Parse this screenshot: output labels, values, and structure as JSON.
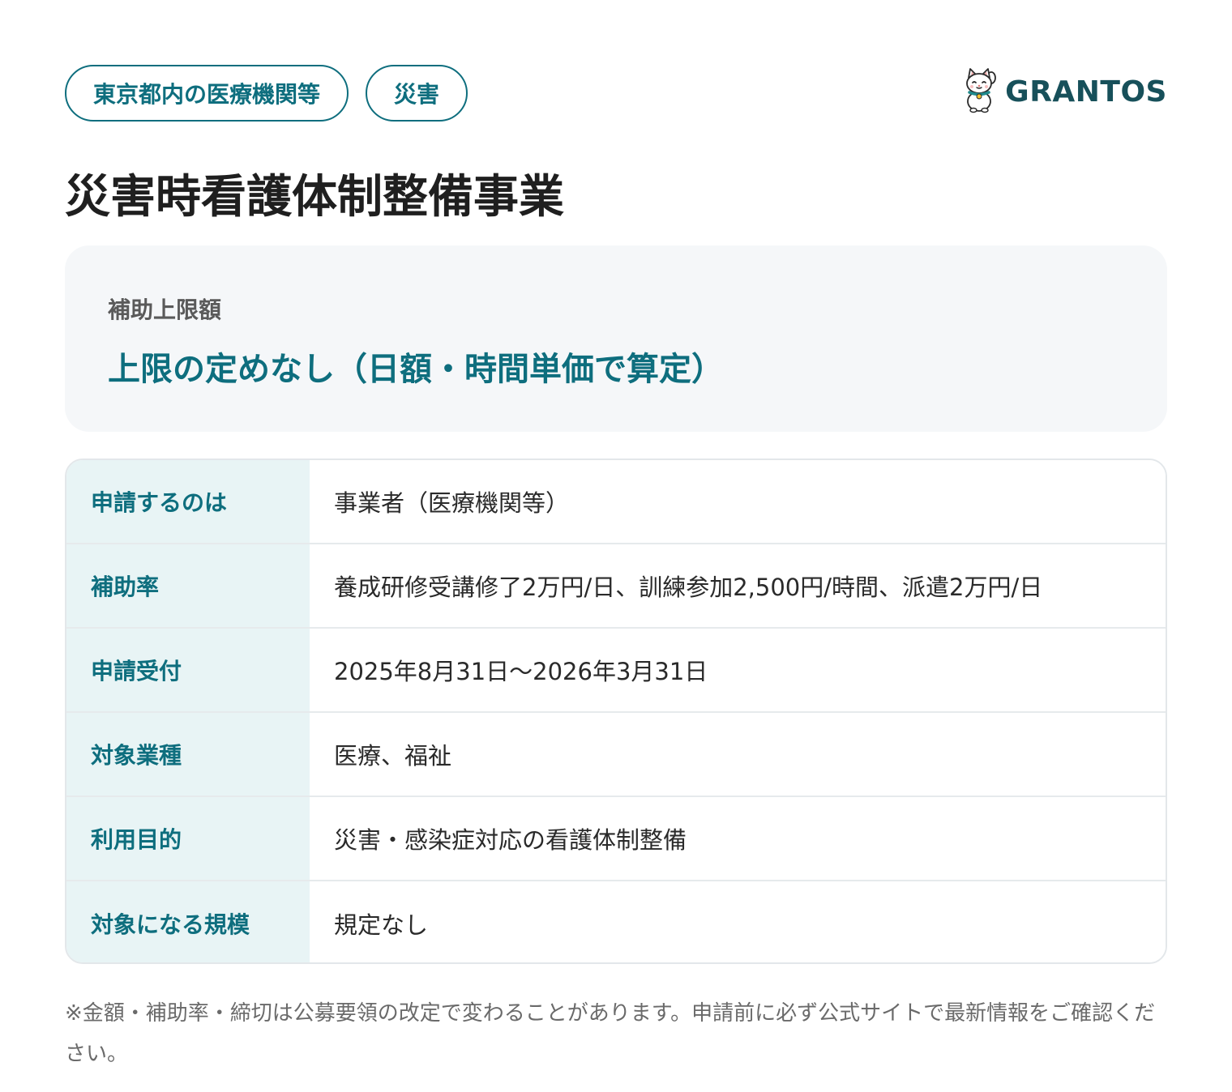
{
  "tags": [
    "東京都内の医療機関等",
    "災害"
  ],
  "logo": {
    "text": "GRANTOS",
    "icon": "maneki-neko-cat-icon"
  },
  "title": "災害時看護体制整備事業",
  "limit": {
    "label": "補助上限額",
    "value": "上限の定めなし（日額・時間単価で算定）"
  },
  "rows": [
    {
      "label": "申請するのは",
      "value": "事業者（医療機関等）"
    },
    {
      "label": "補助率",
      "value": "養成研修受講修了2万円/日、訓練参加2,500円/時間、派遣2万円/日"
    },
    {
      "label": "申請受付",
      "value": "2025年8月31日〜2026年3月31日"
    },
    {
      "label": "対象業種",
      "value": "医療、福祉"
    },
    {
      "label": "利用目的",
      "value": "災害・感染症対応の看護体制整備"
    },
    {
      "label": "対象になる規模",
      "value": "規定なし"
    }
  ],
  "note": "※金額・補助率・締切は公募要領の改定で変わることがあります。申請前に必ず公式サイトで最新情報をご確認ください。",
  "colors": {
    "accent": "#0e6e7e",
    "label_bg": "#e8f4f5",
    "box_bg": "#f5f7f9",
    "logo": "#17505a"
  }
}
